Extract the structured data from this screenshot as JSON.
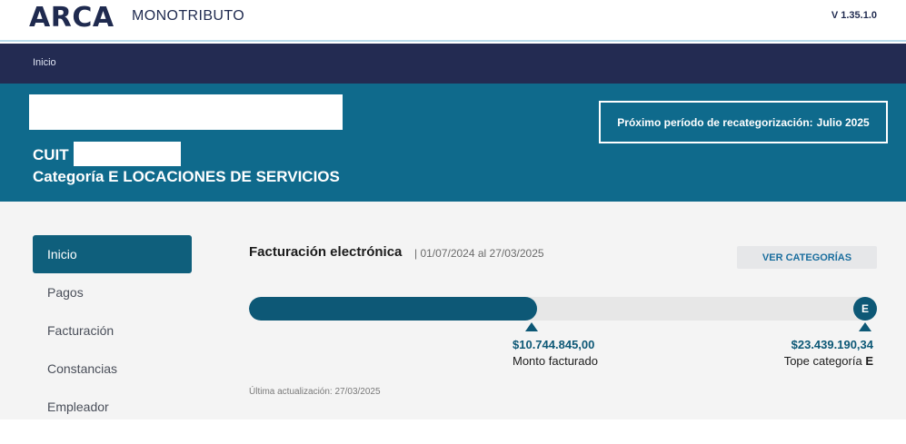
{
  "header": {
    "logo": "ARCA",
    "product": "MONOTRIBUTO",
    "version": "V 1.35.1.0"
  },
  "breadcrumb": {
    "current": "Inicio"
  },
  "banner": {
    "cuit_label": "CUIT",
    "categoria": "Categoría E LOCACIONES DE SERVICIOS",
    "recat_label": "Próximo período de recategorización:",
    "recat_value": "Julio 2025"
  },
  "sidebar": {
    "items": [
      {
        "label": "Inicio",
        "active": true
      },
      {
        "label": "Pagos",
        "active": false
      },
      {
        "label": "Facturación",
        "active": false
      },
      {
        "label": "Constancias",
        "active": false
      },
      {
        "label": "Empleador",
        "active": false
      }
    ]
  },
  "facturacion": {
    "title": "Facturación electrónica",
    "range": "| 01/07/2024 al 27/03/2025",
    "ver_categorias": "VER CATEGORÍAS",
    "category_badge": "E",
    "monto_value": "$10.744.845,00",
    "monto_label": "Monto facturado",
    "tope_value": "$23.439.190,34",
    "tope_label": "Tope categoría",
    "tope_cat": "E",
    "progress_fraction": 0.4584,
    "updated": "Última actualización: 27/03/2025"
  },
  "colors": {
    "navy": "#232b52",
    "banner": "#0f6a8c",
    "accent": "#0d5876",
    "link": "#1a6e9e"
  }
}
